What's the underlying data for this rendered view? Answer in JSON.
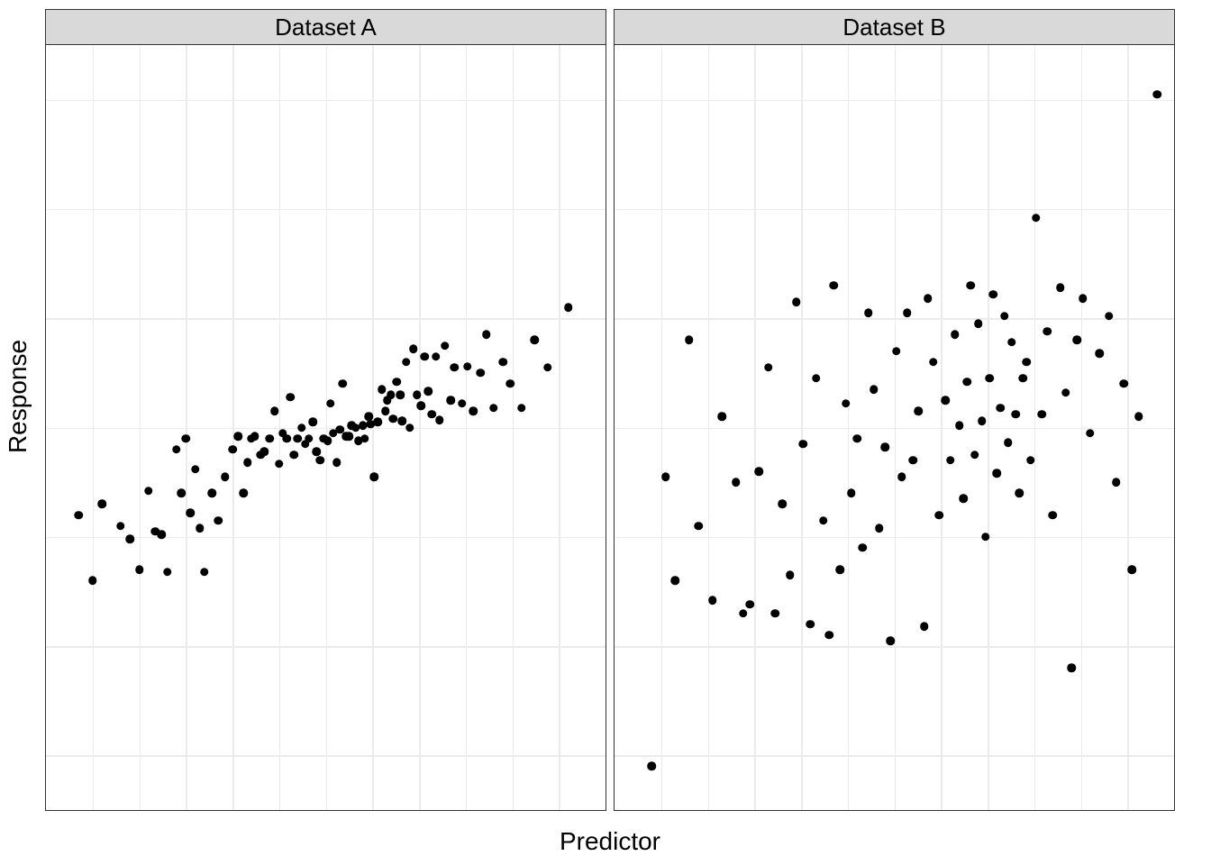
{
  "chart_data": [
    {
      "type": "scatter",
      "facet_label": "Dataset A",
      "xlabel": "Predictor",
      "ylabel": "Response",
      "xlim": [
        -3.0,
        3.0
      ],
      "ylim": [
        -3.5,
        3.5
      ],
      "grid_x": [
        -2.5,
        -2,
        -1.5,
        -1,
        -0.5,
        0,
        0.5,
        1,
        1.5,
        2,
        2.5
      ],
      "grid_y": [
        -3,
        -2,
        -1,
        0,
        1,
        2,
        3
      ],
      "points": [
        [
          -2.65,
          -0.8
        ],
        [
          -2.5,
          -1.4
        ],
        [
          -2.4,
          -0.7
        ],
        [
          -2.2,
          -0.9
        ],
        [
          -2.1,
          -1.02
        ],
        [
          -2.0,
          -1.3
        ],
        [
          -1.9,
          -0.58
        ],
        [
          -1.83,
          -0.95
        ],
        [
          -1.76,
          -0.98
        ],
        [
          -1.7,
          -1.32
        ],
        [
          -1.6,
          -0.2
        ],
        [
          -1.55,
          -0.6
        ],
        [
          -1.5,
          -0.1
        ],
        [
          -1.45,
          -0.78
        ],
        [
          -1.4,
          -0.38
        ],
        [
          -1.35,
          -0.92
        ],
        [
          -1.3,
          -1.32
        ],
        [
          -1.22,
          -0.6
        ],
        [
          -1.15,
          -0.85
        ],
        [
          -1.08,
          -0.45
        ],
        [
          -1.0,
          -0.2
        ],
        [
          -0.94,
          -0.08
        ],
        [
          -0.88,
          -0.6
        ],
        [
          -0.84,
          -0.32
        ],
        [
          -0.8,
          -0.1
        ],
        [
          -0.76,
          -0.08
        ],
        [
          -0.7,
          -0.25
        ],
        [
          -0.66,
          -0.22
        ],
        [
          -0.6,
          -0.1
        ],
        [
          -0.55,
          0.15
        ],
        [
          -0.5,
          -0.33
        ],
        [
          -0.46,
          -0.05
        ],
        [
          -0.42,
          -0.1
        ],
        [
          -0.38,
          0.28
        ],
        [
          -0.34,
          -0.25
        ],
        [
          -0.3,
          -0.1
        ],
        [
          -0.26,
          0.0
        ],
        [
          -0.22,
          -0.15
        ],
        [
          -0.18,
          -0.1
        ],
        [
          -0.14,
          0.05
        ],
        [
          -0.1,
          -0.22
        ],
        [
          -0.06,
          -0.3
        ],
        [
          -0.02,
          -0.1
        ],
        [
          0.02,
          -0.12
        ],
        [
          0.05,
          0.22
        ],
        [
          0.08,
          -0.05
        ],
        [
          0.12,
          -0.32
        ],
        [
          0.15,
          -0.02
        ],
        [
          0.18,
          0.4
        ],
        [
          0.22,
          -0.08
        ],
        [
          0.25,
          -0.08
        ],
        [
          0.28,
          0.02
        ],
        [
          0.32,
          0.0
        ],
        [
          0.35,
          -0.12
        ],
        [
          0.4,
          0.02
        ],
        [
          0.42,
          -0.1
        ],
        [
          0.46,
          0.1
        ],
        [
          0.48,
          0.03
        ],
        [
          0.52,
          -0.45
        ],
        [
          0.56,
          0.05
        ],
        [
          0.6,
          0.35
        ],
        [
          0.64,
          0.15
        ],
        [
          0.66,
          0.25
        ],
        [
          0.7,
          0.3
        ],
        [
          0.72,
          0.08
        ],
        [
          0.76,
          0.42
        ],
        [
          0.8,
          0.3
        ],
        [
          0.82,
          0.06
        ],
        [
          0.86,
          0.6
        ],
        [
          0.9,
          0.0
        ],
        [
          0.94,
          0.72
        ],
        [
          0.98,
          0.3
        ],
        [
          1.02,
          0.2
        ],
        [
          1.06,
          0.65
        ],
        [
          1.1,
          0.33
        ],
        [
          1.14,
          0.12
        ],
        [
          1.18,
          0.65
        ],
        [
          1.22,
          0.07
        ],
        [
          1.28,
          0.75
        ],
        [
          1.34,
          0.25
        ],
        [
          1.38,
          0.55
        ],
        [
          1.46,
          0.22
        ],
        [
          1.52,
          0.56
        ],
        [
          1.58,
          0.15
        ],
        [
          1.66,
          0.5
        ],
        [
          1.72,
          0.85
        ],
        [
          1.8,
          0.18
        ],
        [
          1.9,
          0.6
        ],
        [
          1.98,
          0.4
        ],
        [
          2.1,
          0.18
        ],
        [
          2.24,
          0.8
        ],
        [
          2.38,
          0.55
        ],
        [
          2.6,
          1.1
        ]
      ]
    },
    {
      "type": "scatter",
      "facet_label": "Dataset B",
      "xlabel": "Predictor",
      "ylabel": "Response",
      "xlim": [
        -3.0,
        3.0
      ],
      "ylim": [
        -3.5,
        3.5
      ],
      "grid_x": [
        -2.5,
        -2,
        -1.5,
        -1,
        -0.5,
        0,
        0.5,
        1,
        1.5,
        2,
        2.5
      ],
      "grid_y": [
        -3,
        -2,
        -1,
        0,
        1,
        2,
        3
      ],
      "points": [
        [
          -2.6,
          -3.1
        ],
        [
          -2.45,
          -0.45
        ],
        [
          -2.35,
          -1.4
        ],
        [
          -2.2,
          0.8
        ],
        [
          -2.1,
          -0.9
        ],
        [
          -1.95,
          -1.58
        ],
        [
          -1.85,
          0.1
        ],
        [
          -1.7,
          -0.5
        ],
        [
          -1.62,
          -1.7
        ],
        [
          -1.55,
          -1.62
        ],
        [
          -1.45,
          -0.4
        ],
        [
          -1.35,
          0.55
        ],
        [
          -1.28,
          -1.7
        ],
        [
          -1.2,
          -0.7
        ],
        [
          -1.12,
          -1.35
        ],
        [
          -1.05,
          1.15
        ],
        [
          -0.98,
          -0.15
        ],
        [
          -0.9,
          -1.8
        ],
        [
          -0.84,
          0.45
        ],
        [
          -0.76,
          -0.85
        ],
        [
          -0.7,
          -1.9
        ],
        [
          -0.65,
          1.3
        ],
        [
          -0.58,
          -1.3
        ],
        [
          -0.52,
          0.22
        ],
        [
          -0.46,
          -0.6
        ],
        [
          -0.4,
          -0.1
        ],
        [
          -0.34,
          -1.1
        ],
        [
          -0.28,
          1.05
        ],
        [
          -0.22,
          0.35
        ],
        [
          -0.16,
          -0.92
        ],
        [
          -0.1,
          -0.18
        ],
        [
          -0.04,
          -1.95
        ],
        [
          0.02,
          0.7
        ],
        [
          0.08,
          -0.45
        ],
        [
          0.14,
          1.05
        ],
        [
          0.2,
          -0.3
        ],
        [
          0.26,
          0.15
        ],
        [
          0.32,
          -1.82
        ],
        [
          0.36,
          1.18
        ],
        [
          0.42,
          0.6
        ],
        [
          0.48,
          -0.8
        ],
        [
          0.55,
          0.25
        ],
        [
          0.6,
          -0.3
        ],
        [
          0.65,
          0.85
        ],
        [
          0.7,
          0.02
        ],
        [
          0.74,
          -0.65
        ],
        [
          0.78,
          0.42
        ],
        [
          0.82,
          1.3
        ],
        [
          0.86,
          -0.25
        ],
        [
          0.9,
          0.95
        ],
        [
          0.94,
          0.06
        ],
        [
          0.98,
          -1.0
        ],
        [
          1.02,
          0.45
        ],
        [
          1.06,
          1.22
        ],
        [
          1.1,
          -0.42
        ],
        [
          1.14,
          0.18
        ],
        [
          1.18,
          1.02
        ],
        [
          1.22,
          -0.14
        ],
        [
          1.26,
          0.78
        ],
        [
          1.3,
          0.12
        ],
        [
          1.34,
          -0.6
        ],
        [
          1.38,
          0.45
        ],
        [
          1.42,
          0.6
        ],
        [
          1.46,
          -0.3
        ],
        [
          1.52,
          1.92
        ],
        [
          1.58,
          0.12
        ],
        [
          1.64,
          0.88
        ],
        [
          1.7,
          -0.8
        ],
        [
          1.78,
          1.28
        ],
        [
          1.84,
          0.32
        ],
        [
          1.9,
          -2.2
        ],
        [
          1.96,
          0.8
        ],
        [
          2.02,
          1.18
        ],
        [
          2.1,
          -0.05
        ],
        [
          2.2,
          0.68
        ],
        [
          2.3,
          1.02
        ],
        [
          2.38,
          -0.5
        ],
        [
          2.46,
          0.4
        ],
        [
          2.55,
          -1.3
        ],
        [
          2.62,
          0.1
        ],
        [
          2.82,
          3.05
        ]
      ]
    }
  ],
  "axis_labels": {
    "x": "Predictor",
    "y": "Response"
  }
}
